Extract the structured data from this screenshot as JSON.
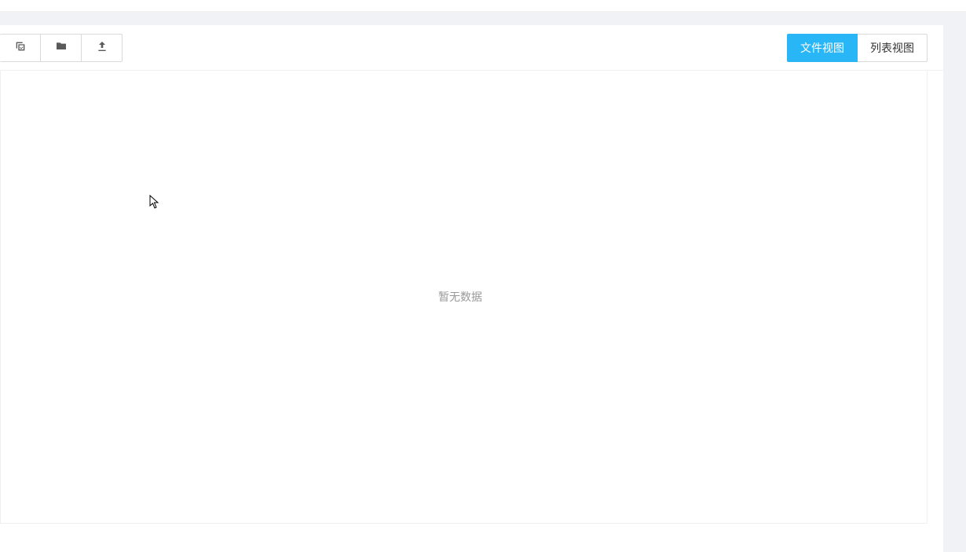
{
  "toolbar": {
    "icons": {
      "select": "select-all-icon",
      "folder": "folder-icon",
      "upload": "upload-icon"
    }
  },
  "views": {
    "file": "文件视图",
    "list": "列表视图"
  },
  "content": {
    "empty": "暂无数据"
  }
}
